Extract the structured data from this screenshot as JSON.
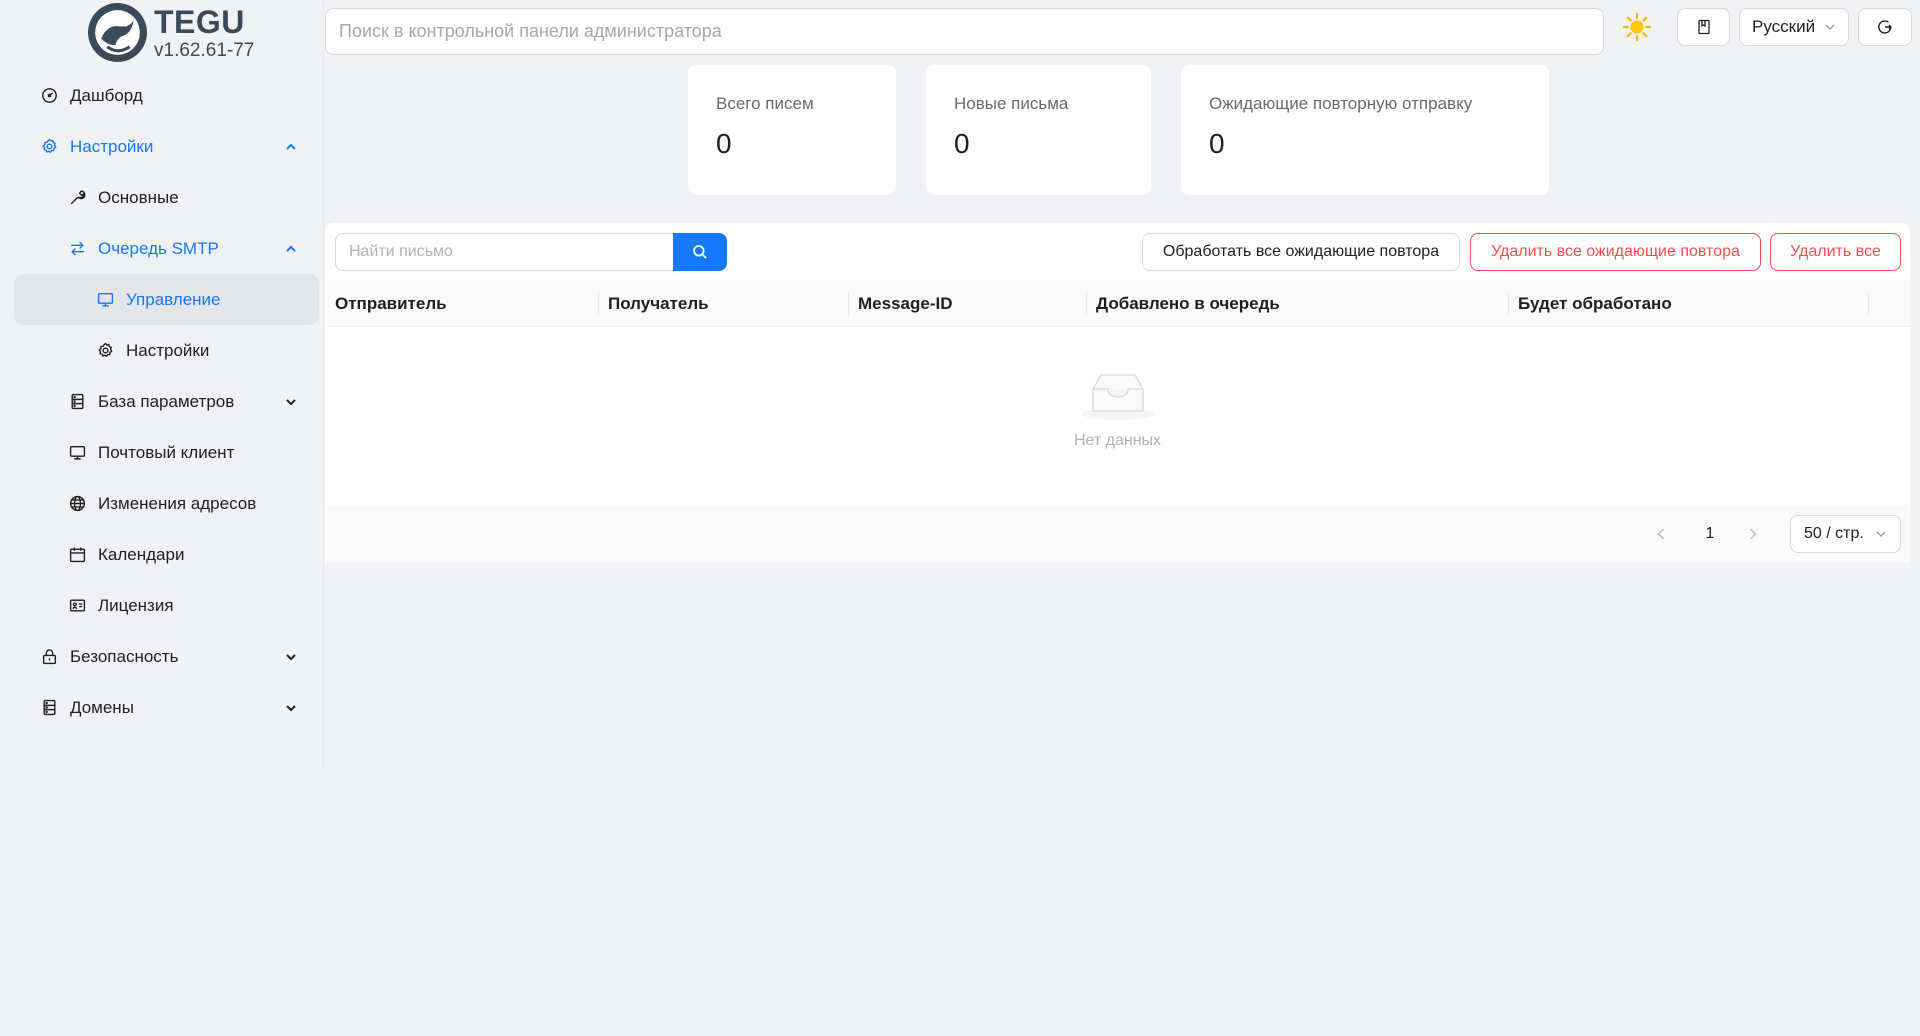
{
  "app": {
    "name": "TEGU",
    "version": "v1.62.61-77"
  },
  "sidebar": {
    "items": [
      {
        "label": "Дашборд",
        "icon": "dashboard-icon"
      },
      {
        "label": "Настройки",
        "icon": "gear-icon",
        "expanded": true
      },
      {
        "label": "Основные",
        "icon": "wrench-icon"
      },
      {
        "label": "Очередь SMTP",
        "icon": "swap-icon",
        "expanded": true
      },
      {
        "label": "Управление",
        "icon": "monitor-icon",
        "selected": true
      },
      {
        "label": "Настройки",
        "icon": "gear-icon"
      },
      {
        "label": "База параметров",
        "icon": "database-icon"
      },
      {
        "label": "Почтовый клиент",
        "icon": "monitor-icon"
      },
      {
        "label": "Изменения адресов",
        "icon": "globe-icon"
      },
      {
        "label": "Календари",
        "icon": "calendar-icon"
      },
      {
        "label": "Лицензия",
        "icon": "id-card-icon"
      },
      {
        "label": "Безопасность",
        "icon": "lock-icon"
      },
      {
        "label": "Домены",
        "icon": "database-icon"
      }
    ]
  },
  "header": {
    "search_placeholder": "Поиск в контрольной панели администратора",
    "language": "Русский"
  },
  "stats": [
    {
      "title": "Всего писем",
      "value": "0"
    },
    {
      "title": "Новые письма",
      "value": "0"
    },
    {
      "title": "Ожидающие повторную отправку",
      "value": "0"
    }
  ],
  "toolbar": {
    "find_placeholder": "Найти письмо",
    "process_label": "Обработать все ожидающие повтора",
    "delete_pending_label": "Удалить все ожидающие повтора",
    "delete_all_label": "Удалить все"
  },
  "table": {
    "columns": [
      "Отправитель",
      "Получатель",
      "Message-ID",
      "Добавлено в очередь",
      "Будет обработано"
    ],
    "empty_text": "Нет данных"
  },
  "pagination": {
    "current_page": "1",
    "page_size": "50 / стр."
  },
  "colors": {
    "accent": "#1677ff",
    "danger": "#ff4d4f",
    "background": "#f0f2f5"
  }
}
